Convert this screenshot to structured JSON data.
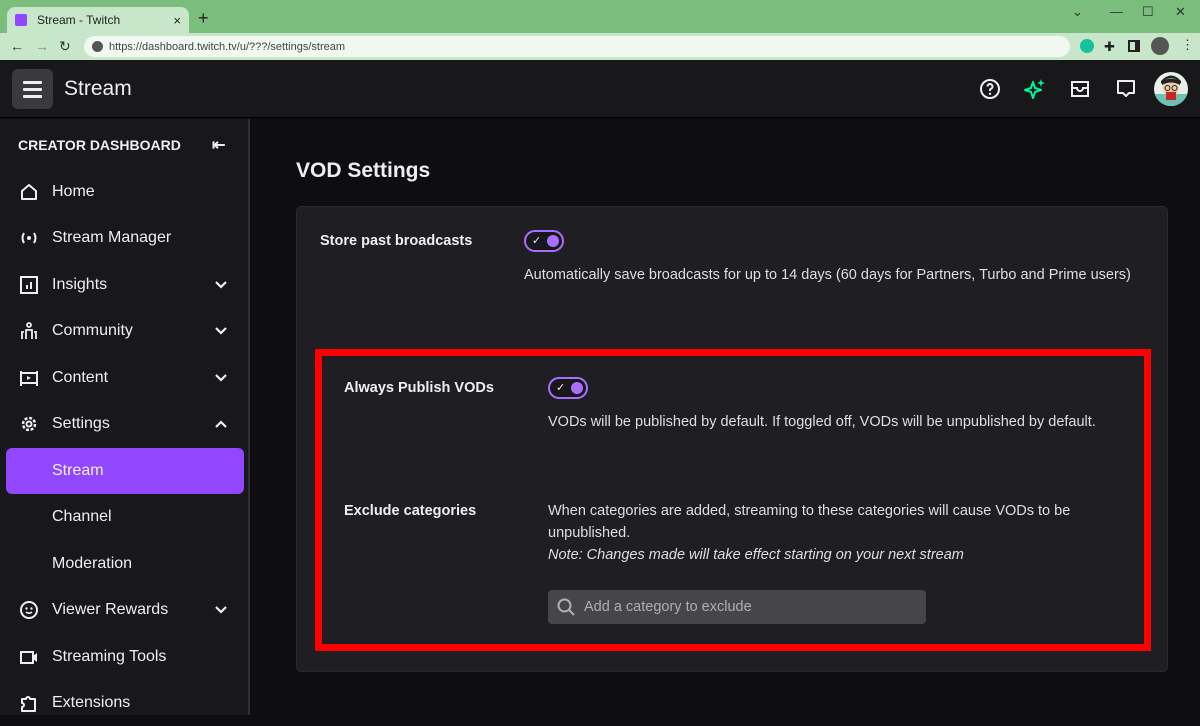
{
  "browser": {
    "tab_title": "Stream - Twitch",
    "url": "https://dashboard.twitch.tv/u/???/settings/stream",
    "new_tab_label": "+",
    "close_tab_label": "×"
  },
  "header": {
    "title": "Stream",
    "icons": [
      "help-icon",
      "sparkle-icon",
      "inbox-icon",
      "whispers-icon",
      "avatar"
    ]
  },
  "sidebar": {
    "heading": "CREATOR DASHBOARD",
    "collapse_label": "⇤",
    "items": [
      {
        "label": "Home",
        "icon": "home-icon"
      },
      {
        "label": "Stream Manager",
        "icon": "broadcast-icon"
      },
      {
        "label": "Insights",
        "icon": "insights-icon",
        "chevron": "down"
      },
      {
        "label": "Community",
        "icon": "community-icon",
        "chevron": "down"
      },
      {
        "label": "Content",
        "icon": "content-icon",
        "chevron": "down"
      },
      {
        "label": "Settings",
        "icon": "gear-icon",
        "chevron": "up"
      },
      {
        "label": "Stream",
        "sub": true,
        "active": true
      },
      {
        "label": "Channel",
        "sub": true
      },
      {
        "label": "Moderation",
        "sub": true
      },
      {
        "label": "Viewer Rewards",
        "icon": "smiley-icon",
        "chevron": "down"
      },
      {
        "label": "Streaming Tools",
        "icon": "camera-icon"
      },
      {
        "label": "Extensions",
        "icon": "puzzle-icon"
      }
    ]
  },
  "main": {
    "section_title": "VOD Settings",
    "store_past": {
      "label": "Store past broadcasts",
      "enabled": true,
      "description": "Automatically save broadcasts for up to 14 days (60 days for Partners, Turbo and Prime users)"
    },
    "always_publish": {
      "label": "Always Publish VODs",
      "enabled": true,
      "description": "VODs will be published by default. If toggled off, VODs will be unpublished by default."
    },
    "exclude_categories": {
      "label": "Exclude categories",
      "description": "When categories are added, streaming to these categories will cause VODs to be unpublished.",
      "note": "Note: Changes made will take effect starting on your next stream",
      "search_placeholder": "Add a category to exclude"
    }
  },
  "colors": {
    "accent": "#9146ff",
    "toggle": "#a970ff",
    "highlight": "#ff0000",
    "sparkle": "#00f593"
  }
}
